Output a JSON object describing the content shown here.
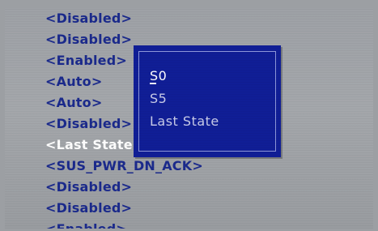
{
  "settings_values": [
    {
      "label": "<Disabled>",
      "selected": false
    },
    {
      "label": "<Disabled>",
      "selected": false
    },
    {
      "label": "<Enabled>",
      "selected": false
    },
    {
      "label": "<Auto>",
      "selected": false
    },
    {
      "label": "<Auto>",
      "selected": false
    },
    {
      "label": "<Disabled>",
      "selected": false
    },
    {
      "label": "<Last State",
      "selected": true
    },
    {
      "label": "<SUS_PWR_DN_ACK>",
      "selected": false
    },
    {
      "label": "<Disabled>",
      "selected": false
    },
    {
      "label": "<Disabled>",
      "selected": false
    },
    {
      "label": "<Enabled>",
      "selected": false
    }
  ],
  "popup": {
    "options": [
      {
        "label": "S0",
        "highlighted": true
      },
      {
        "label": "S5",
        "highlighted": false
      },
      {
        "label": "Last State",
        "highlighted": false
      }
    ]
  },
  "colors": {
    "screen_background": "#9c9fa3",
    "value_text": "#1b2a8c",
    "selected_text": "#ffffff",
    "popup_background": "#101e96",
    "popup_border": "#8d96d8",
    "popup_text": "#c8cbe8"
  }
}
